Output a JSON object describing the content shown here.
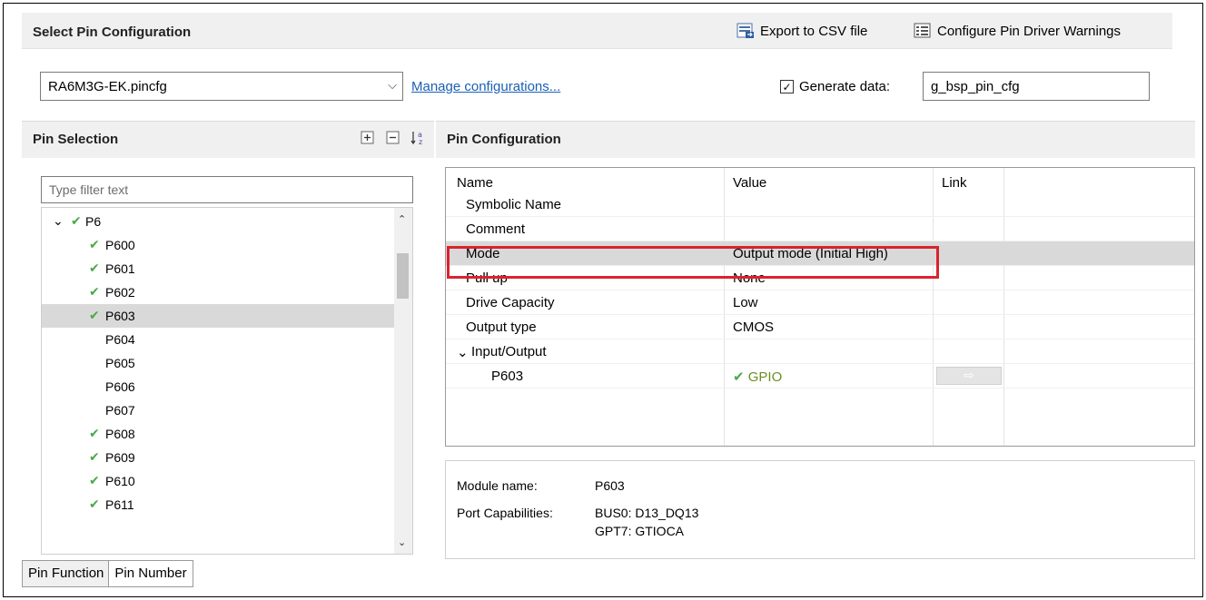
{
  "select_section": {
    "title": "Select Pin Configuration",
    "export_label": "Export to CSV file",
    "configure_warnings_label": "Configure Pin Driver Warnings",
    "config_file": "RA6M3G-EK.pincfg",
    "manage_link": "Manage configurations...",
    "generate_label": "Generate data:",
    "generate_checked": true,
    "generate_value": "g_bsp_pin_cfg"
  },
  "pin_selection": {
    "title": "Pin Selection",
    "filter_placeholder": "Type filter text",
    "icons": [
      "expand-all-icon",
      "collapse-all-icon",
      "sort-az-icon"
    ],
    "tree": [
      {
        "label": "P6",
        "checked": true,
        "expanded": true,
        "level": 0
      },
      {
        "label": "P600",
        "checked": true,
        "level": 1
      },
      {
        "label": "P601",
        "checked": true,
        "level": 1
      },
      {
        "label": "P602",
        "checked": true,
        "level": 1
      },
      {
        "label": "P603",
        "checked": true,
        "level": 1,
        "selected": true
      },
      {
        "label": "P604",
        "checked": false,
        "level": 1
      },
      {
        "label": "P605",
        "checked": false,
        "level": 1
      },
      {
        "label": "P606",
        "checked": false,
        "level": 1
      },
      {
        "label": "P607",
        "checked": false,
        "level": 1
      },
      {
        "label": "P608",
        "checked": true,
        "level": 1
      },
      {
        "label": "P609",
        "checked": true,
        "level": 1
      },
      {
        "label": "P610",
        "checked": true,
        "level": 1
      },
      {
        "label": "P611",
        "checked": true,
        "level": 1
      }
    ]
  },
  "pin_configuration": {
    "title": "Pin Configuration",
    "columns": [
      "Name",
      "Value",
      "Link"
    ],
    "rows": [
      {
        "name": "Symbolic Name",
        "value": ""
      },
      {
        "name": "Comment",
        "value": ""
      },
      {
        "name": "Mode",
        "value": "Output mode (Initial High)",
        "highlighted": true
      },
      {
        "name": "Pull up",
        "value": "None"
      },
      {
        "name": "Drive Capacity",
        "value": "Low"
      },
      {
        "name": "Output type",
        "value": "CMOS"
      },
      {
        "name": "Input/Output",
        "value": "",
        "expandable": true
      },
      {
        "name": "P603",
        "value": "GPIO",
        "sub": true,
        "link": true
      }
    ],
    "details": {
      "module_label": "Module name:",
      "module_value": "P603",
      "port_label": "Port Capabilities:",
      "port_values": [
        "BUS0: D13_DQ13",
        "GPT7: GTIOCA"
      ]
    }
  },
  "bottom_tabs": [
    "Pin Function",
    "Pin Number"
  ],
  "colors": {
    "highlight_border": "#d9232d",
    "check_green": "#4aa84a",
    "link_blue": "#1a5fb4",
    "header_gray": "#f0f0f0",
    "selected_row": "#d9d9d9"
  }
}
